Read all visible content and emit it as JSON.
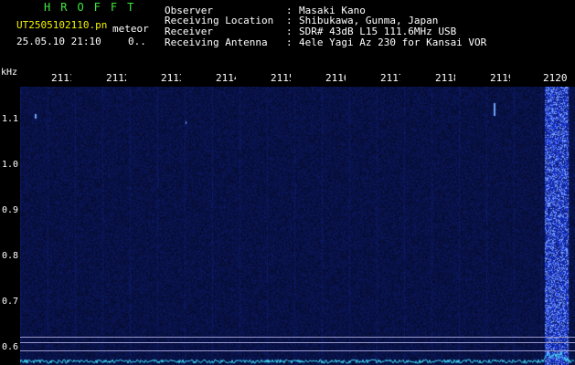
{
  "header": {
    "logo": "HROFFT",
    "filename": "UT2505102110.pn",
    "meteor_label": "meteor",
    "datetime": "25.05.10 21:10",
    "count": "0.."
  },
  "info": [
    {
      "label": "Observer",
      "value": "Masaki Kano"
    },
    {
      "label": "Receiving Location",
      "value": "Shibukawa, Gunma, Japan"
    },
    {
      "label": "Receiver",
      "value": "SDR# 43dB L15 111.6MHz USB"
    },
    {
      "label": "Receiving Antenna",
      "value": "4ele Yagi Az 230 for Kansai VOR"
    }
  ],
  "info_separator": ":",
  "y_axis": {
    "unit": "kHz",
    "ticks": [
      "1.1",
      "1.0",
      "0.9",
      "0.8",
      "0.7",
      "0.6"
    ]
  },
  "x_axis": {
    "ticks": [
      "2111",
      "2112",
      "2113",
      "2114",
      "2115",
      "2116",
      "2117",
      "2118",
      "2119",
      "2120"
    ]
  },
  "colors": {
    "background": "#000000",
    "plot_bg": "#000028",
    "noise": "#1e3cc8",
    "signal": "#6fa8ff",
    "hline": "#c8c8ff",
    "green_text": "#3fe83f",
    "yellow_text": "#f2f200"
  }
}
